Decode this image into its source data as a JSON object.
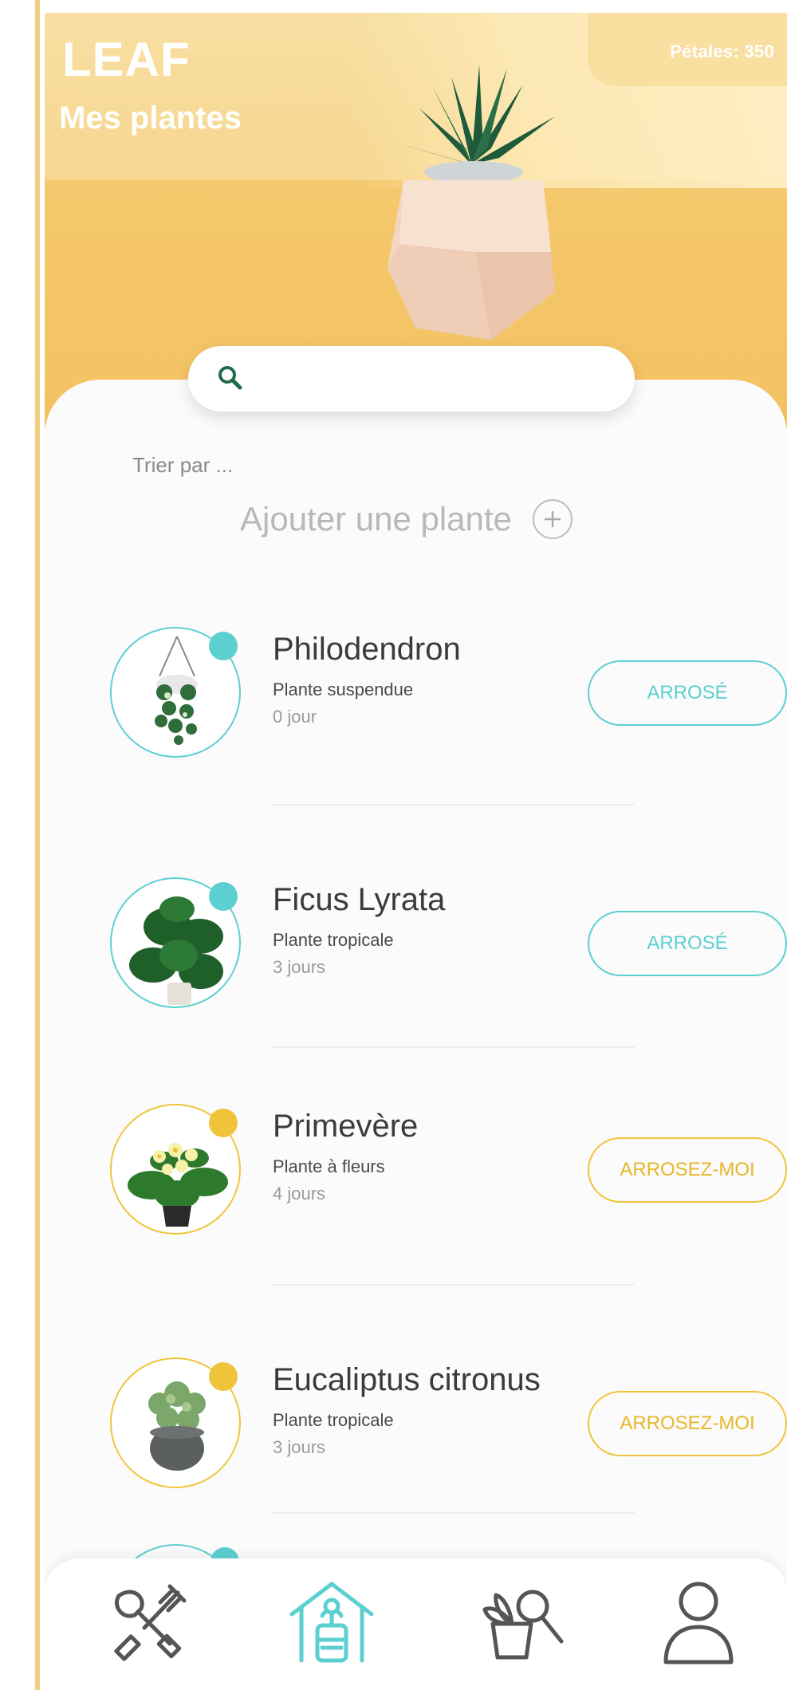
{
  "header": {
    "brand": "LEAF",
    "subtitle": "Mes plantes",
    "petales": "Pétales: 350"
  },
  "search": {
    "placeholder": "",
    "icon": "search-icon"
  },
  "sort_label": "Trier par ...",
  "add_plant_label": "Ajouter une plante",
  "plants": [
    {
      "name": "Philodendron",
      "type": "Plante suspendue",
      "days": "0 jour",
      "status_color": "teal",
      "action": "ARROSÉ"
    },
    {
      "name": "Ficus Lyrata",
      "type": "Plante tropicale",
      "days": "3 jours",
      "status_color": "teal",
      "action": "ARROSÉ"
    },
    {
      "name": "Primevère",
      "type": "Plante à fleurs",
      "days": "4 jours",
      "status_color": "gold",
      "action": "ARROSEZ-MOI"
    },
    {
      "name": "Eucaliptus citronus",
      "type": "Plante tropicale",
      "days": "3 jours",
      "status_color": "gold",
      "action": "ARROSEZ-MOI"
    }
  ],
  "nav": [
    {
      "icon": "garden-tools-icon",
      "active": false
    },
    {
      "icon": "home-plant-icon",
      "active": true
    },
    {
      "icon": "plant-search-icon",
      "active": false
    },
    {
      "icon": "profile-icon",
      "active": false
    }
  ],
  "colors": {
    "teal": "#5ccfd0",
    "gold": "#f0c43a",
    "hero": "#f4c86c"
  }
}
